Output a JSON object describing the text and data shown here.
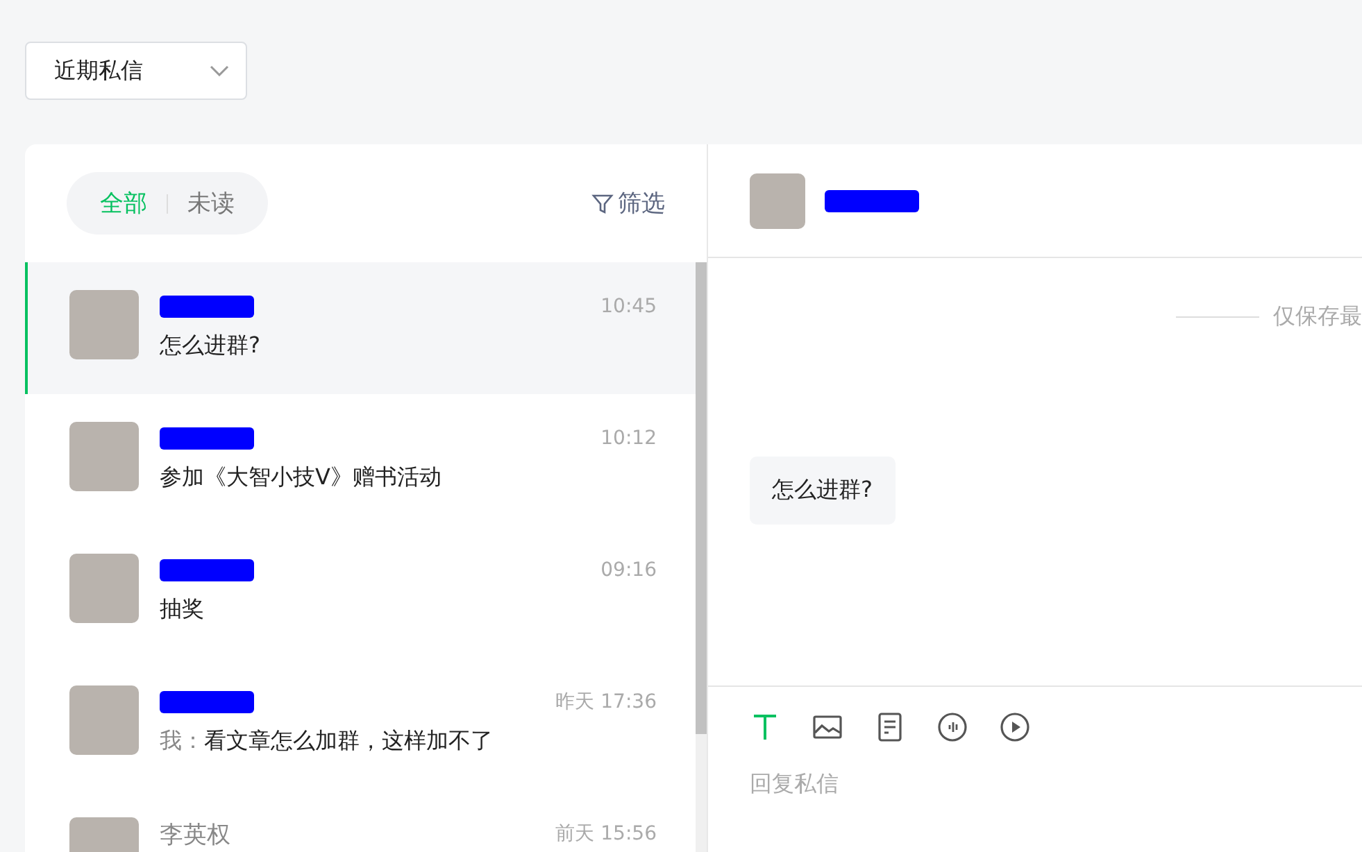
{
  "filter_dropdown": {
    "value": "近期私信"
  },
  "tabs": [
    {
      "label": "全部",
      "selected": true
    },
    {
      "label": "未读",
      "selected": false
    }
  ],
  "filter_button": {
    "label": "筛选"
  },
  "conversations": [
    {
      "name_hidden": true,
      "time": "10:45",
      "preview": "怎么进群?",
      "selected": true
    },
    {
      "name_hidden": true,
      "time": "10:12",
      "preview": "参加《大智小技V》赠书活动",
      "selected": false
    },
    {
      "name_hidden": true,
      "time": "09:16",
      "preview": "抽奖",
      "selected": false
    },
    {
      "name_hidden": true,
      "time": "昨天 17:36",
      "preview_prefix": "我：",
      "preview": "看文章怎么加群，这样加不了",
      "selected": false
    },
    {
      "name_hidden": false,
      "name": "李英权",
      "time": "前天 15:56",
      "selected": false
    }
  ],
  "chat": {
    "name_hidden": true,
    "notice": "仅保存最",
    "messages": [
      {
        "text": "怎么进群?"
      }
    ]
  },
  "composer": {
    "tools": [
      {
        "kind": "text",
        "selected": true
      },
      {
        "kind": "image",
        "selected": false
      },
      {
        "kind": "document",
        "selected": false
      },
      {
        "kind": "voice",
        "selected": false
      },
      {
        "kind": "video",
        "selected": false
      }
    ],
    "placeholder": "回复私信"
  }
}
